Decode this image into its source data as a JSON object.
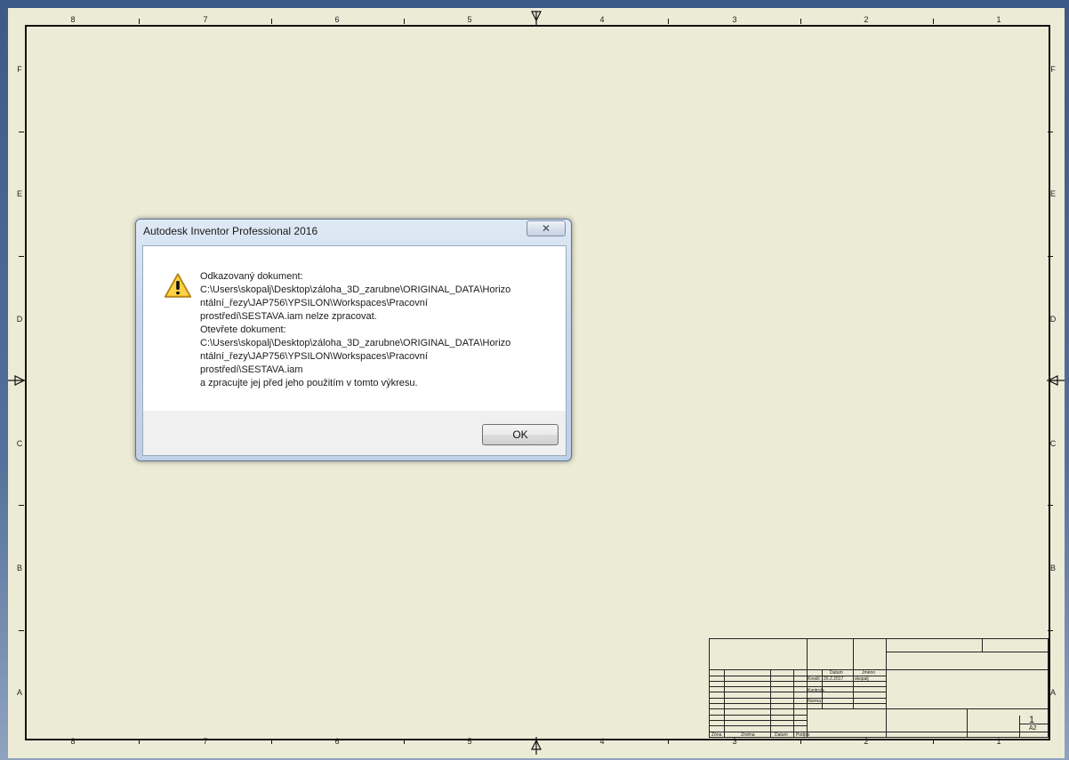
{
  "drawing": {
    "column_labels": [
      "8",
      "7",
      "6",
      "5",
      "4",
      "3",
      "2",
      "1"
    ],
    "row_labels": [
      "F",
      "E",
      "D",
      "C",
      "B",
      "A"
    ],
    "title_block": {
      "datum_label": "Datum",
      "jmeno_label": "Jméno",
      "kreslil_label": "Kreslil",
      "kreslil_date": "20.2.2017",
      "kreslil_name": "skopalj",
      "kontrola_label": "Kontrola",
      "norma_label": "Norma",
      "zona_label": "Zóna",
      "zmena_label": "Změna",
      "datum_label_2": "Datum",
      "podpis_label": "Podpis",
      "sheet_number": "1",
      "sheet_format": "A2"
    }
  },
  "dialog": {
    "title": "Autodesk Inventor Professional 2016",
    "close_glyph": "✕",
    "icon": "warning-icon",
    "message_lines": [
      "Odkazovaný dokument:",
      "C:\\Users\\skopalj\\Desktop\\záloha_3D_zarubne\\ORIGINAL_DATA\\Horizo",
      "ntální_řezy\\JAP756\\YPSILON\\Workspaces\\Pracovní",
      "prostředí\\SESTAVA.iam nelze zpracovat.",
      "Otevřete dokument:",
      "C:\\Users\\skopalj\\Desktop\\záloha_3D_zarubne\\ORIGINAL_DATA\\Horizo",
      "ntální_řezy\\JAP756\\YPSILON\\Workspaces\\Pracovní",
      "prostředí\\SESTAVA.iam",
      "a zpracujte jej před jeho použitím v tomto výkresu."
    ],
    "ok_label": "OK"
  },
  "colors": {
    "sheet": "#ecebd6",
    "background": "#3b5a86",
    "warning": "#f2b705"
  }
}
